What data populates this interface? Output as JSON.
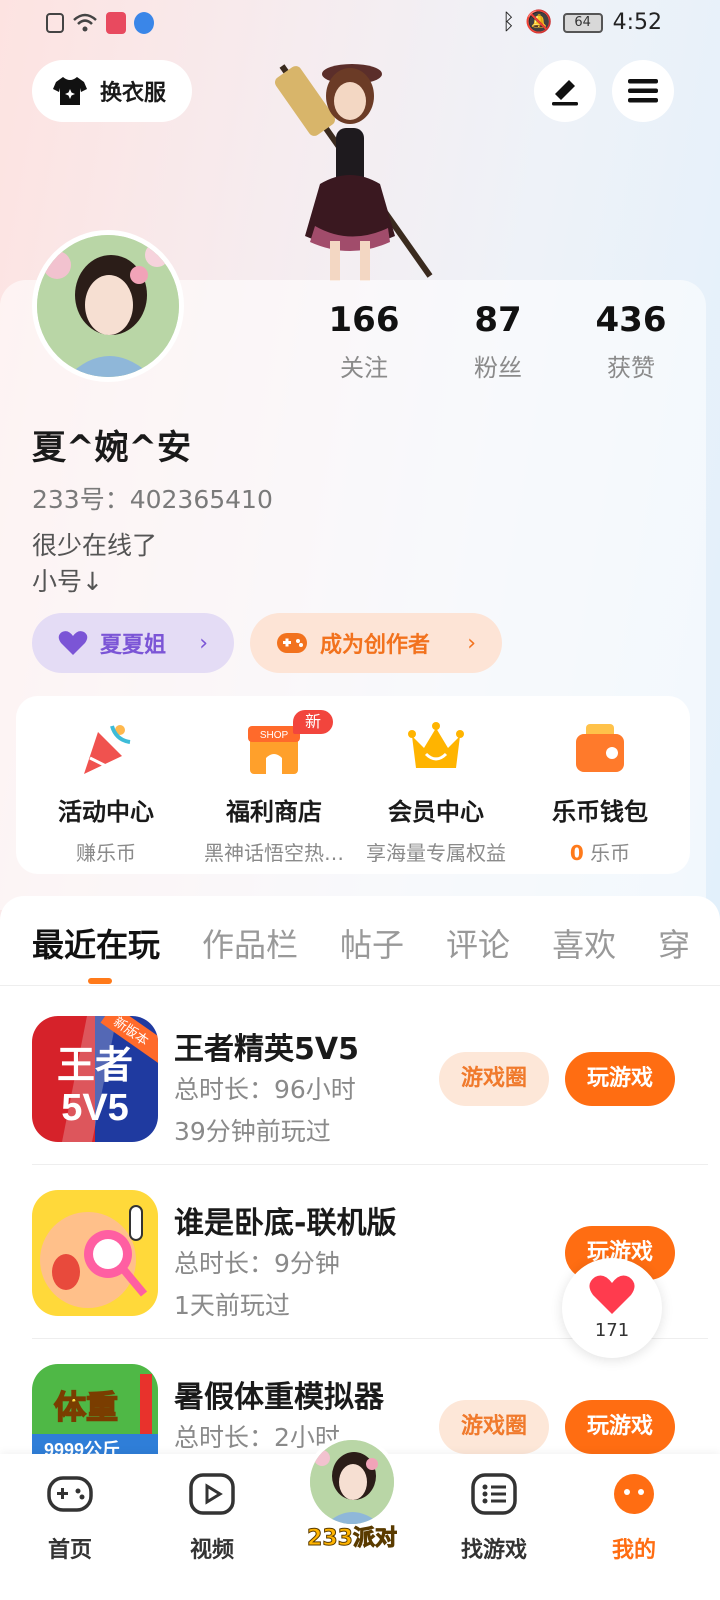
{
  "status_bar": {
    "time": "4:52",
    "battery": "64"
  },
  "header": {
    "outfit_label": "换衣服"
  },
  "profile": {
    "username": "夏^婉^安",
    "uid_label": "233号：402365410",
    "bio_line1": "很少在线了",
    "bio_line2": "小号↓",
    "stats": [
      {
        "value": "166",
        "label": "关注"
      },
      {
        "value": "87",
        "label": "粉丝"
      },
      {
        "value": "436",
        "label": "获赞"
      }
    ],
    "pill_friend": "夏夏姐",
    "pill_creator": "成为创作者"
  },
  "quick": [
    {
      "title": "活动中心",
      "sub": "赚乐币"
    },
    {
      "title": "福利商店",
      "sub": "黑神话悟空热…",
      "badge": "新",
      "icon_text": "SHOP"
    },
    {
      "title": "会员中心",
      "sub": "享海量专属权益"
    },
    {
      "title": "乐币钱包",
      "sub_value": "0",
      "sub_unit": "乐币"
    }
  ],
  "tabs": [
    "最近在玩",
    "作品栏",
    "帖子",
    "评论",
    "喜欢",
    "穿"
  ],
  "games": [
    {
      "name": "王者精英5V5",
      "duration": "总时长：96小时",
      "last": "39分钟前玩过",
      "icon_text": "王者\n5V5",
      "icon_badge": "新版本",
      "has_circle": true
    },
    {
      "name": "谁是卧底-联机版",
      "duration": "总时长：9分钟",
      "last": "1天前玩过",
      "has_circle": false
    },
    {
      "name": "暑假体重模拟器",
      "duration": "总时长：2小时",
      "last": "",
      "icon_text": "体重",
      "icon_sub": "9999公斤",
      "has_circle": true
    }
  ],
  "buttons": {
    "circle": "游戏圈",
    "play": "玩游戏"
  },
  "like_float": {
    "count": "171"
  },
  "nav": [
    {
      "label": "首页",
      "icon": "gamepad-icon"
    },
    {
      "label": "视频",
      "icon": "video-icon"
    },
    {
      "label": "233派对",
      "icon": "party-avatar"
    },
    {
      "label": "找游戏",
      "icon": "list-icon"
    },
    {
      "label": "我的",
      "icon": "profile-icon"
    }
  ],
  "colors": {
    "accent": "#ff6d12",
    "purple": "#7b55d6",
    "badge_red": "#f2453d"
  }
}
